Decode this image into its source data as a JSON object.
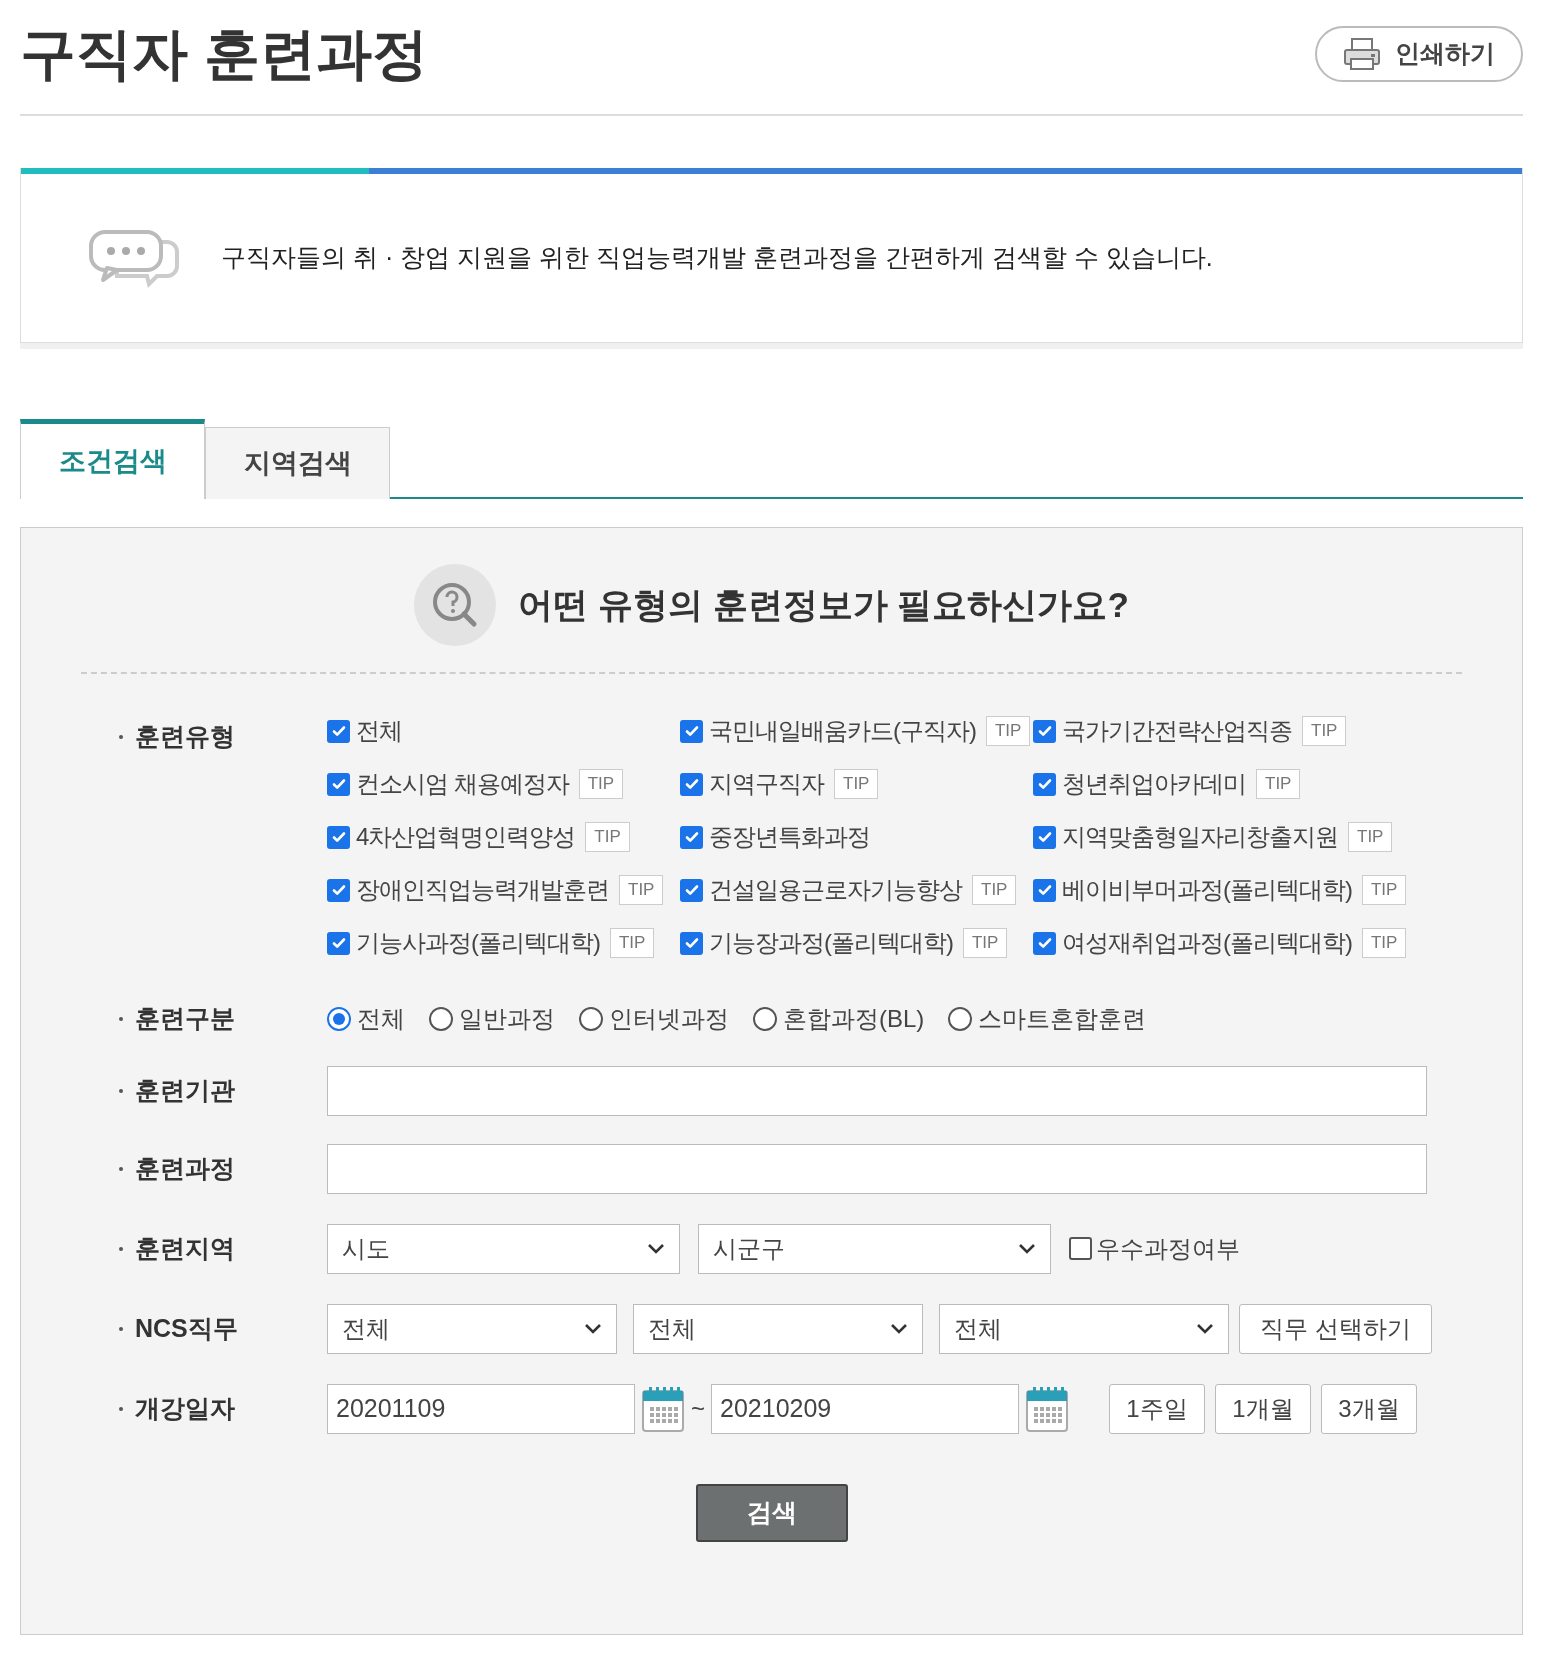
{
  "page_title": "구직자 훈련과정",
  "print_button": "인쇄하기",
  "intro": "구직자들의 취 · 창업 지원을 위한 직업능력개발 훈련과정을 간편하게 검색할 수 있습니다.",
  "tabs": [
    {
      "label": "조건검색",
      "selected": true
    },
    {
      "label": "지역검색",
      "selected": false
    }
  ],
  "form": {
    "heading": "어떤 유형의 훈련정보가 필요하신가요?",
    "training_type": {
      "label": "훈련유형",
      "options": [
        {
          "label": "전체",
          "checked": true
        },
        {
          "label": "국민내일배움카드(구직자)",
          "checked": true,
          "tip": "TIP"
        },
        {
          "label": "국가기간전략산업직종",
          "checked": true,
          "tip": "TIP"
        },
        {
          "label": "컨소시엄 채용예정자",
          "checked": true,
          "tip": "TIP"
        },
        {
          "label": "지역구직자",
          "checked": true,
          "tip": "TIP"
        },
        {
          "label": "청년취업아카데미",
          "checked": true,
          "tip": "TIP"
        },
        {
          "label": "4차산업혁명인력양성",
          "checked": true,
          "tip": "TIP"
        },
        {
          "label": "중장년특화과정",
          "checked": true
        },
        {
          "label": "지역맞춤형일자리창출지원",
          "checked": true,
          "tip": "TIP"
        },
        {
          "label": "장애인직업능력개발훈련",
          "checked": true,
          "tip": "TIP"
        },
        {
          "label": "건설일용근로자기능향상",
          "checked": true,
          "tip": "TIP"
        },
        {
          "label": "베이비부머과정(폴리텍대학)",
          "checked": true,
          "tip": "TIP"
        },
        {
          "label": "기능사과정(폴리텍대학)",
          "checked": true,
          "tip": "TIP"
        },
        {
          "label": "기능장과정(폴리텍대학)",
          "checked": true,
          "tip": "TIP"
        },
        {
          "label": "여성재취업과정(폴리텍대학)",
          "checked": true,
          "tip": "TIP"
        }
      ]
    },
    "training_category": {
      "label": "훈련구분",
      "options": [
        {
          "label": "전체",
          "selected": true
        },
        {
          "label": "일반과정",
          "selected": false
        },
        {
          "label": "인터넷과정",
          "selected": false
        },
        {
          "label": "혼합과정(BL)",
          "selected": false
        },
        {
          "label": "스마트혼합훈련",
          "selected": false
        }
      ]
    },
    "institution": {
      "label": "훈련기관"
    },
    "course": {
      "label": "훈련과정"
    },
    "region": {
      "label": "훈련지역",
      "selects": [
        "시도",
        "시군구"
      ],
      "excellent": {
        "label": "우수과정여부",
        "checked": false
      }
    },
    "ncs": {
      "label": "NCS직무",
      "selects": [
        "전체",
        "전체",
        "전체"
      ],
      "button": "직무 선택하기"
    },
    "start_date": {
      "label": "개강일자",
      "from": "20201109",
      "separator": "~",
      "to": "20210209",
      "ranges": [
        "1주일",
        "1개월",
        "3개월"
      ]
    },
    "search_button": "검색"
  }
}
